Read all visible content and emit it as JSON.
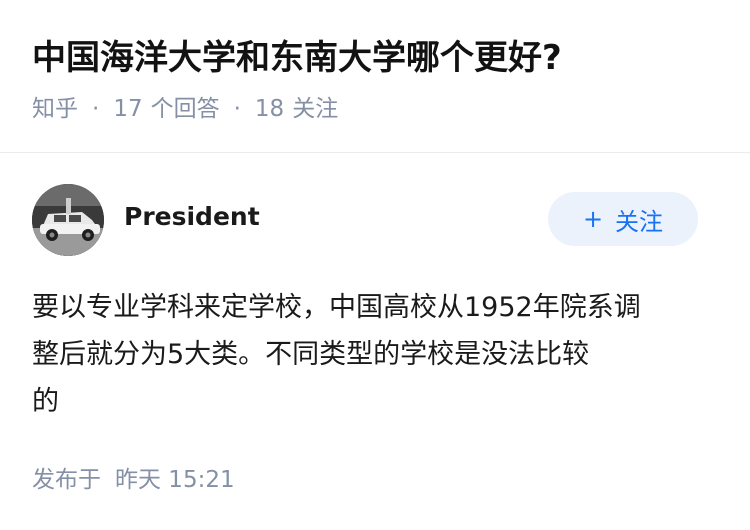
{
  "question": {
    "title": "中国海洋大学和东南大学哪个更好?",
    "meta": {
      "source": "知乎",
      "answer_count": "17",
      "answer_label": "个回答",
      "follow_count": "18",
      "follow_label": "关注"
    }
  },
  "answer": {
    "author": {
      "name": "President",
      "avatar_icon": "avatar-photo-car"
    },
    "follow_button": {
      "plus": "+",
      "label": "关注",
      "bg_color": "#ebf2fb",
      "text_color": "#1772f6"
    },
    "content_lines": [
      "要以专业学科来定学校，中国高校从1952年院系调",
      "整后就分为5大类。不同类型的学校是没法比较",
      "的"
    ],
    "published": {
      "label": "发布于",
      "time": "昨天 15:21"
    }
  }
}
